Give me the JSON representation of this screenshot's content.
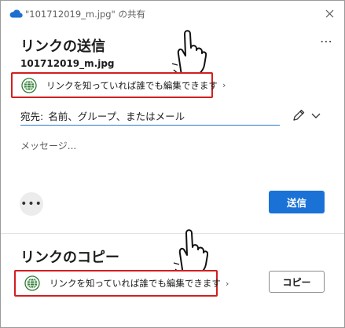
{
  "window": {
    "title": "\"101712019_m.jpg\" の共有",
    "close_icon": "close-icon",
    "app_icon": "onedrive-cloud-icon"
  },
  "send_section": {
    "title": "リンクの送信",
    "file_name": "101712019_m.jpg",
    "link_setting": "リンクを知っていれば誰でも編集できます",
    "chevron": "›",
    "to_label": "宛先:",
    "to_placeholder": "名前、グループ、またはメール",
    "message_placeholder": "メッセージ...",
    "more_options": "•••",
    "send_label": "送信"
  },
  "copy_section": {
    "title": "リンクのコピー",
    "link_setting": "リンクを知っていれば誰でも編集できます",
    "chevron": "›",
    "copy_label": "コピー"
  },
  "header_more": "⋯",
  "colors": {
    "accent": "#1a72d6",
    "highlight_border": "#d21f1f",
    "globe": "#2e7d32"
  }
}
